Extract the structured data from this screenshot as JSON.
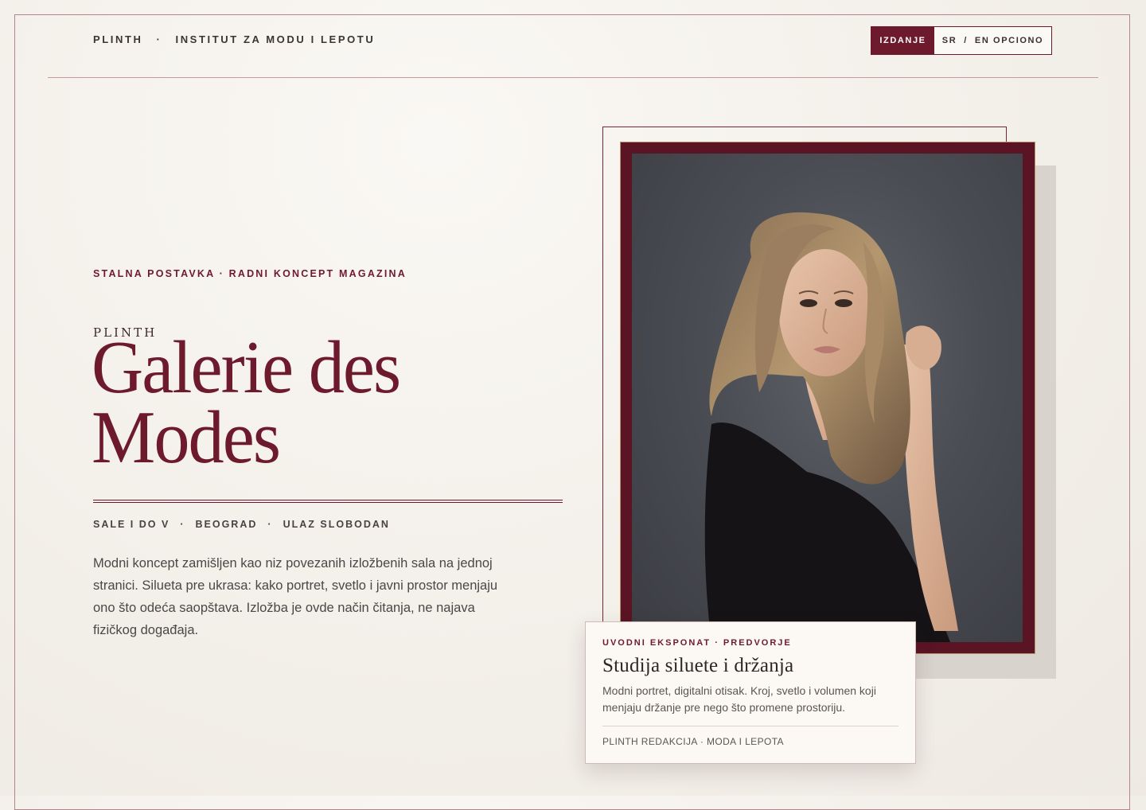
{
  "topbar": {
    "brand": "PLINTH",
    "separator": "·",
    "institute": "INSTITUT ZA MODU I LEPOTU"
  },
  "edition_switch": {
    "label": "IZDANJE",
    "lang_primary": "SR",
    "lang_separator": "/",
    "lang_secondary": "EN OPCIONO"
  },
  "hero": {
    "kicker": "STALNA POSTAVKA · RADNI KONCEPT MAGAZINA",
    "brand_small": "PLINTH",
    "title_line1": "Galerie des",
    "title_line2": "Modes",
    "meta": [
      "SALE I DO V",
      "BEOGRAD",
      "ULAZ SLOBODAN"
    ],
    "meta_separator": "·",
    "intro": "Modni koncept zamišljen kao niz povezanih izložbenih sala na jednoj stranici. Silueta pre ukrasa: kako portret, svetlo i javni prostor menjaju ono što odeća saopštava. Izložba je ovde način čitanja, ne najava fizičkog događaja."
  },
  "caption": {
    "kicker": "UVODNI EKSPONAT · PREDVORJE",
    "title": "Studija siluete i držanja",
    "description": "Modni portret, digitalni otisak. Kroj, svetlo i volumen koji menjaju držanje pre nego što promene prostoriju.",
    "credit": "PLINTH REDAKCIJA · MODA I LEPOTA"
  },
  "colors": {
    "accent": "#6e1a2d",
    "frame": "#5a1424",
    "background": "#f3efe9"
  }
}
